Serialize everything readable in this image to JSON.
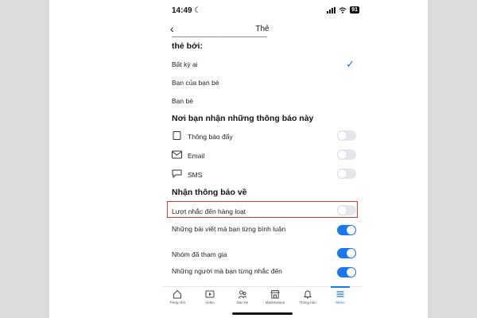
{
  "status_bar": {
    "time": "14:49",
    "battery": "91"
  },
  "header": {
    "title": "Thẻ"
  },
  "who_section": {
    "heading_cut": "thẻ bởi:",
    "options": [
      {
        "label": "Bất kỳ ai",
        "selected": true
      },
      {
        "label": "Bạn của bạn bè",
        "selected": false
      },
      {
        "label": "Bạn bè",
        "selected": false
      }
    ]
  },
  "where_section": {
    "heading": "Nơi bạn nhận những thông báo này",
    "items": [
      {
        "label": "Thông báo đẩy",
        "icon": "push-notification-icon",
        "on": false
      },
      {
        "label": "Email",
        "icon": "email-icon",
        "on": false
      },
      {
        "label": "SMS",
        "icon": "sms-icon",
        "on": false
      }
    ]
  },
  "about_section": {
    "heading": "Nhận thông báo về",
    "items": [
      {
        "label": "Lượt nhắc đến hàng loạt",
        "on": false,
        "highlighted": true
      },
      {
        "label": "Những bài viết mà bạn từng bình luận",
        "on": true
      },
      {
        "label": "Nhóm đã tham gia",
        "on": true
      },
      {
        "label": "Những người mà bạn từng nhắc đến",
        "on": true
      }
    ]
  },
  "bottom_nav": {
    "items": [
      {
        "label": "Trang chủ",
        "icon": "home-icon"
      },
      {
        "label": "Video",
        "icon": "video-icon"
      },
      {
        "label": "Bạn bè",
        "icon": "friends-icon"
      },
      {
        "label": "Marketplace",
        "icon": "marketplace-icon"
      },
      {
        "label": "Thông báo",
        "icon": "bell-icon"
      },
      {
        "label": "Menu",
        "icon": "menu-icon",
        "active": true
      }
    ]
  },
  "colors": {
    "accent": "#1877f2",
    "highlight_border": "#d93a3a",
    "toggle_off": "#e4e6eb"
  }
}
